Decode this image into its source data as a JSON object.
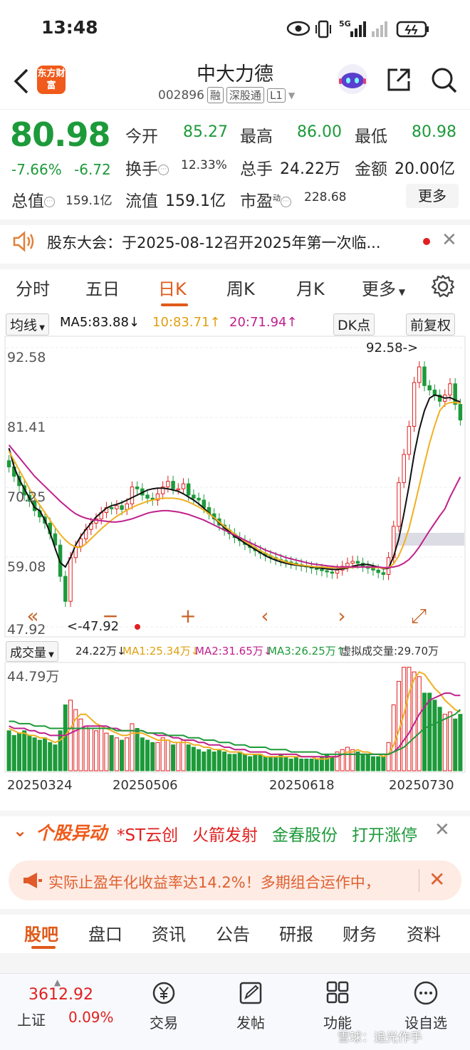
{
  "status": {
    "time": "13:48",
    "network": "5G"
  },
  "header": {
    "logo_text": "东方财富",
    "stock_name": "中大力德",
    "code": "002896",
    "tags": [
      "融",
      "深股通",
      "L1"
    ]
  },
  "quote": {
    "price": "80.98",
    "change_pct": "-7.66%",
    "change_amt": "-6.72",
    "open_label": "今开",
    "open": "85.27",
    "high_label": "最高",
    "high": "86.00",
    "low_label": "最低",
    "low": "80.98",
    "turnover_label": "换手",
    "turnover": "12.33%",
    "volume_label": "总手",
    "volume": "24.22万",
    "amount_label": "金额",
    "amount": "20.00亿",
    "mktcap_label": "总值",
    "mktcap": "159.1亿",
    "float_label": "流值",
    "float": "159.1亿",
    "pe_label": "市盈",
    "pe_sup": "动",
    "pe": "228.68",
    "more_label": "更多"
  },
  "notice": {
    "text": "股东大会：于2025-08-12召开2025年第一次临..."
  },
  "period_tabs": [
    "分时",
    "五日",
    "日K",
    "周K",
    "月K",
    "更多"
  ],
  "active_period": "日K",
  "ma_row": {
    "selector": "均线",
    "ma5": "MA5:83.88↓",
    "ma10": "10:83.71↑",
    "ma20": "20:71.94↑",
    "dk": "DK点",
    "adjust": "前复权"
  },
  "colors": {
    "up": "#e02020",
    "down": "#1d9a3a",
    "ma5": "#111111",
    "ma10": "#f0b020",
    "ma20": "#c0208c",
    "accent": "#f05a1a"
  },
  "chart_data": [
    {
      "type": "candlestick",
      "y_ticks": [
        "92.58",
        "81.41",
        "70.25",
        "59.08",
        "47.92"
      ],
      "ylim": [
        47.92,
        92.58
      ],
      "annotations": {
        "high_label": "92.58->",
        "low_label": "<-47.92"
      },
      "close": [
        73.5,
        72.0,
        70.5,
        69.0,
        68.0,
        66.5,
        65.5,
        64.5,
        62.8,
        61.0,
        56.0,
        52.0,
        59.0,
        60.8,
        62.0,
        63.5,
        64.5,
        65.2,
        66.2,
        67.0,
        66.8,
        67.3,
        66.7,
        67.6,
        70.3,
        70.0,
        69.0,
        68.5,
        68.2,
        69.2,
        70.3,
        71.2,
        70.0,
        70.0,
        70.8,
        69.0,
        68.5,
        68.2,
        67.0,
        66.0,
        65.2,
        64.2,
        63.4,
        62.8,
        62.2,
        61.7,
        61.1,
        60.6,
        60.1,
        59.7,
        59.3,
        59.0,
        58.7,
        58.5,
        58.3,
        58.1,
        57.9,
        57.7,
        57.5,
        57.3,
        57.1,
        56.9,
        56.7,
        56.5,
        57.0,
        57.6,
        58.1,
        58.4,
        58.1,
        57.6,
        57.3,
        57.0,
        56.6,
        56.3,
        59.0,
        64.0,
        71.0,
        75.5,
        80.0,
        87.0,
        89.5,
        86.5,
        85.8,
        85.0,
        84.0,
        85.0,
        86.8,
        83.5,
        81.0
      ],
      "ma5": [
        76.5,
        73.5,
        71.5,
        70.0,
        68.5,
        67.0,
        66.5,
        65.0,
        63.0,
        60.5,
        58.2,
        57.5,
        59.0,
        61.0,
        62.4,
        63.5,
        64.5,
        65.5,
        66.2,
        66.9,
        67.3,
        67.5,
        67.8,
        68.2,
        68.6,
        69.0,
        69.4,
        69.8,
        70.0,
        70.1,
        70.1,
        70.0,
        69.8,
        69.6,
        69.2,
        68.7,
        68.2,
        67.6,
        66.9,
        66.1,
        65.3,
        64.6,
        63.8,
        63.1,
        62.4,
        61.9,
        61.3,
        60.8,
        60.3,
        59.8,
        59.3,
        58.9,
        58.6,
        58.3,
        58.1,
        57.9,
        57.8,
        57.7,
        57.6,
        57.5,
        57.4,
        57.3,
        57.2,
        57.1,
        57.1,
        57.2,
        57.3,
        57.6,
        57.8,
        57.9,
        57.9,
        57.7,
        57.5,
        57.2,
        57.3,
        59.2,
        62.0,
        66.0,
        70.5,
        75.5,
        79.5,
        82.5,
        84.5,
        85.0,
        84.8,
        84.5,
        84.6,
        84.2,
        83.9
      ],
      "ma10": [
        76.0,
        74.5,
        73.0,
        71.5,
        70.0,
        68.6,
        67.4,
        66.2,
        65.0,
        63.8,
        62.7,
        61.8,
        61.1,
        60.7,
        60.6,
        61.2,
        62.0,
        62.8,
        63.6,
        64.3,
        65.0,
        65.6,
        66.1,
        66.6,
        67.0,
        67.4,
        67.7,
        68.0,
        68.2,
        68.4,
        68.5,
        68.5,
        68.5,
        68.4,
        68.2,
        67.9,
        67.5,
        67.1,
        66.6,
        66.0,
        65.4,
        64.7,
        64.0,
        63.4,
        62.8,
        62.2,
        61.6,
        61.1,
        60.6,
        60.1,
        59.7,
        59.3,
        58.9,
        58.6,
        58.3,
        58.1,
        57.9,
        57.8,
        57.7,
        57.6,
        57.5,
        57.5,
        57.4,
        57.4,
        57.4,
        57.4,
        57.4,
        57.4,
        57.5,
        57.5,
        57.5,
        57.4,
        57.4,
        57.3,
        57.4,
        58.0,
        59.3,
        61.2,
        63.7,
        67.0,
        70.5,
        74.0,
        77.3,
        80.1,
        82.5,
        83.5,
        83.8,
        83.8,
        83.7
      ],
      "ma20": [
        77.0,
        76.0,
        75.0,
        74.0,
        73.0,
        72.0,
        71.2,
        70.4,
        69.6,
        68.8,
        68.0,
        67.3,
        66.6,
        66.0,
        65.6,
        65.3,
        65.1,
        65.0,
        64.9,
        64.8,
        64.7,
        64.7,
        64.8,
        65.0,
        65.2,
        65.5,
        65.8,
        66.1,
        66.3,
        66.4,
        66.5,
        66.5,
        66.4,
        66.3,
        66.1,
        65.9,
        65.6,
        65.3,
        65.0,
        64.6,
        64.2,
        63.8,
        63.4,
        63.0,
        62.6,
        62.2,
        61.8,
        61.4,
        61.0,
        60.6,
        60.2,
        59.9,
        59.6,
        59.3,
        59.0,
        58.8,
        58.6,
        58.4,
        58.2,
        58.0,
        57.9,
        57.8,
        57.7,
        57.6,
        57.5,
        57.5,
        57.5,
        57.5,
        57.5,
        57.5,
        57.5,
        57.5,
        57.5,
        57.4,
        57.4,
        57.5,
        57.7,
        58.1,
        58.7,
        59.6,
        60.7,
        62.0,
        63.3,
        64.5,
        65.7,
        66.8,
        68.7,
        70.3,
        71.9
      ]
    },
    {
      "type": "bar",
      "title": "成交量",
      "y_tick": "44.79万",
      "ylim": [
        0,
        44.79
      ],
      "x_ticks": [
        "20250324",
        "20250506",
        "20250618",
        "20250730"
      ],
      "legend": {
        "vol": "24.22万↓",
        "ma1": "MA1:25.34万↓",
        "ma2": "MA2:31.65万↓",
        "ma3": "MA3:26.25万↑",
        "virtual": "虚拟成交量:29.70万"
      },
      "values": [
        17,
        15,
        16,
        17,
        15,
        14,
        13,
        14,
        12,
        11,
        17,
        28,
        30,
        26,
        22,
        19,
        18,
        17,
        19,
        16,
        15,
        14,
        13,
        14,
        20,
        18,
        14,
        13,
        12,
        12,
        14,
        13,
        11,
        12,
        13,
        11,
        10,
        9,
        8,
        9,
        8,
        9,
        8,
        7,
        7,
        8,
        7,
        6,
        7,
        7,
        6,
        6,
        6,
        7,
        6,
        5,
        6,
        5,
        5,
        5,
        5,
        6,
        7,
        6,
        8,
        9,
        10,
        9,
        8,
        7,
        7,
        6,
        6,
        6,
        12,
        28,
        38,
        44,
        44,
        42,
        40,
        33,
        33,
        30,
        27,
        24,
        25,
        22,
        24
      ],
      "ma1": [
        18,
        17,
        16,
        16,
        15,
        15,
        14,
        14,
        13,
        12,
        13,
        15,
        18,
        22,
        24,
        24,
        22,
        20,
        19,
        18,
        17,
        16,
        15,
        15,
        16,
        16,
        16,
        15,
        14,
        13,
        13,
        13,
        12,
        12,
        12,
        12,
        11,
        11,
        10,
        10,
        9,
        9,
        9,
        8,
        8,
        8,
        7,
        7,
        7,
        7,
        6,
        6,
        6,
        6,
        6,
        6,
        6,
        6,
        6,
        6,
        5,
        5,
        5,
        6,
        6,
        7,
        8,
        8,
        9,
        8,
        8,
        7,
        7,
        6,
        7,
        11,
        17,
        24,
        33,
        39,
        42,
        41,
        38,
        35,
        33,
        30,
        28,
        26,
        25
      ],
      "ma2": [
        19,
        18,
        18,
        18,
        17,
        17,
        16,
        16,
        15,
        15,
        15,
        15,
        16,
        17,
        18,
        19,
        19,
        19,
        19,
        19,
        18,
        18,
        17,
        17,
        17,
        17,
        17,
        16,
        16,
        15,
        15,
        15,
        14,
        14,
        13,
        13,
        13,
        12,
        12,
        11,
        11,
        11,
        10,
        10,
        9,
        9,
        9,
        8,
        8,
        8,
        8,
        7,
        7,
        7,
        7,
        7,
        7,
        6,
        6,
        6,
        6,
        6,
        6,
        6,
        6,
        7,
        7,
        7,
        7,
        7,
        7,
        7,
        7,
        7,
        7,
        8,
        10,
        13,
        16,
        20,
        24,
        27,
        30,
        31,
        32,
        33,
        33,
        32,
        32
      ],
      "ma3": [
        21,
        21,
        20,
        20,
        20,
        19,
        19,
        19,
        18,
        18,
        18,
        18,
        18,
        18,
        18,
        18,
        18,
        18,
        18,
        18,
        18,
        17,
        17,
        17,
        17,
        17,
        17,
        16,
        16,
        16,
        16,
        15,
        15,
        15,
        15,
        14,
        14,
        14,
        13,
        13,
        13,
        12,
        12,
        12,
        11,
        11,
        11,
        10,
        10,
        10,
        10,
        9,
        9,
        9,
        9,
        8,
        8,
        8,
        8,
        8,
        8,
        7,
        7,
        7,
        7,
        7,
        7,
        7,
        7,
        7,
        7,
        7,
        7,
        7,
        7,
        8,
        9,
        10,
        12,
        14,
        16,
        18,
        19,
        20,
        21,
        22,
        23,
        24,
        26
      ]
    }
  ],
  "chart_controls": [
    "«",
    "−",
    "+",
    "‹",
    "›",
    "⤢"
  ],
  "movers": {
    "title": "个股异动",
    "items": [
      {
        "name": "*ST云创",
        "action": "火箭发射"
      },
      {
        "name": "金春股份",
        "action": "打开涨停"
      }
    ]
  },
  "promo": {
    "text": "实际止盈年化收益率达14.2%！多期组合运作中，"
  },
  "bottom_tabs": [
    "股吧",
    "盘口",
    "资讯",
    "公告",
    "研报",
    "财务",
    "资料"
  ],
  "active_bottom_tab": "股吧",
  "bottom_nav": {
    "index_value": "3612.92",
    "index_name": "上证",
    "index_change": "0.09%",
    "items": [
      {
        "label": "交易",
        "icon": "yen-circle-icon"
      },
      {
        "label": "发帖",
        "icon": "edit-post-icon"
      },
      {
        "label": "功能",
        "icon": "grid-icon"
      },
      {
        "label": "设自选",
        "icon": "dots-circle-icon"
      }
    ]
  },
  "watermark": "雪球：追光作手"
}
